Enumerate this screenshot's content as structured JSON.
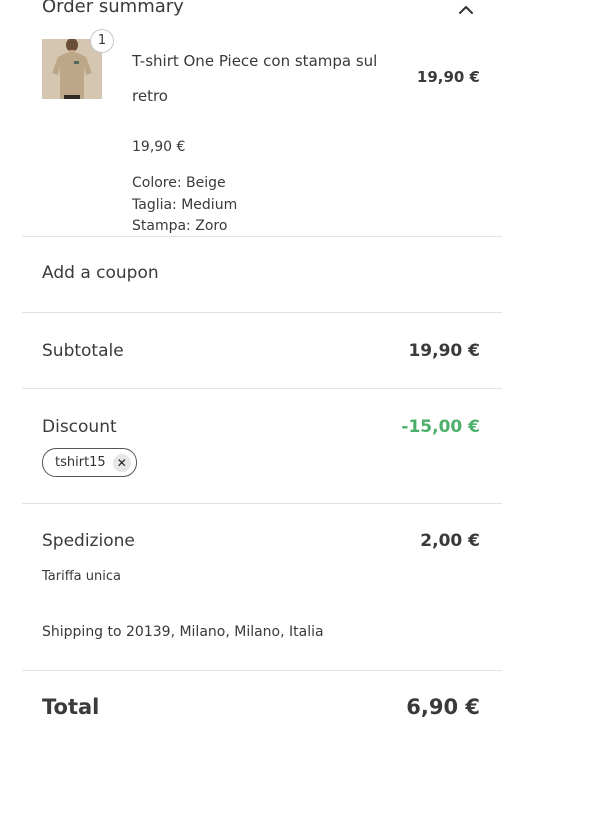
{
  "summary": {
    "title": "Order summary",
    "toggle_icon": "chevron-up-icon"
  },
  "product": {
    "quantity": "1",
    "name": "T-shirt One Piece con stampa sul retro",
    "line_total": "19,90 €",
    "unit_price": "19,90 €",
    "options": [
      "Colore: Beige",
      "Taglia: Medium",
      "Stampa: Zoro"
    ]
  },
  "coupon": {
    "label": "Add a coupon"
  },
  "subtotal": {
    "label": "Subtotale",
    "value": "19,90 €"
  },
  "discount": {
    "label": "Discount",
    "value": "-15,00 €",
    "code": "tshirt15",
    "remove_icon": "close-icon",
    "color": "#4caf6a"
  },
  "shipping": {
    "label": "Spedizione",
    "value": "2,00 €",
    "rate": "Tariffa unica",
    "destination": "Shipping to 20139, Milano, Milano, Italia"
  },
  "total": {
    "label": "Total",
    "value": "6,90 €"
  }
}
